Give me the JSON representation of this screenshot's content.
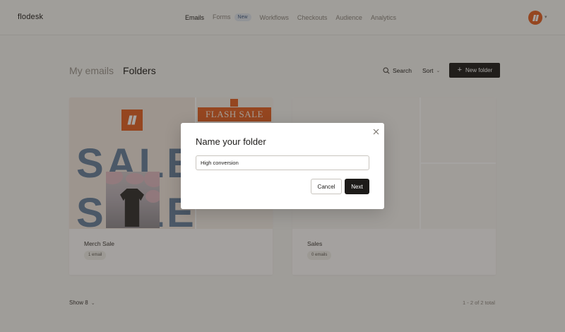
{
  "app": {
    "brand": "flodesk"
  },
  "nav": {
    "items": [
      {
        "label": "Emails"
      },
      {
        "label": "Forms",
        "badge": "New"
      },
      {
        "label": "Workflows"
      },
      {
        "label": "Checkouts"
      },
      {
        "label": "Audience"
      },
      {
        "label": "Analytics"
      }
    ],
    "active": "Emails"
  },
  "page": {
    "tabs": [
      {
        "label": "My emails"
      },
      {
        "label": "Folders"
      }
    ],
    "active_tab": "Folders",
    "search_label": "Search",
    "sort_label": "Sort",
    "new_folder_label": "New folder"
  },
  "folders": [
    {
      "name": "Merch Sale",
      "count": "1 email",
      "thumbnail_text": {
        "sale": "SALE",
        "flash": "FLASH SALE"
      }
    },
    {
      "name": "Sales",
      "count": "0 emails"
    }
  ],
  "footer": {
    "show_label": "Show 8",
    "pagination": "1 - 2 of 2 total"
  },
  "modal": {
    "title": "Name your folder",
    "input_value": "High conversion",
    "cancel_label": "Cancel",
    "next_label": "Next"
  },
  "icons": {
    "avatar": "flodesk-logo-icon",
    "search": "search-icon",
    "sort": "chevron-down-icon",
    "new_folder": "plus-icon",
    "close": "close-icon"
  },
  "colors": {
    "brand_orange": "#e35f22",
    "primary_dark": "#1d1b19",
    "badge_bg": "#dfe5ee",
    "overlay": "rgba(40,36,32,0.42)"
  }
}
